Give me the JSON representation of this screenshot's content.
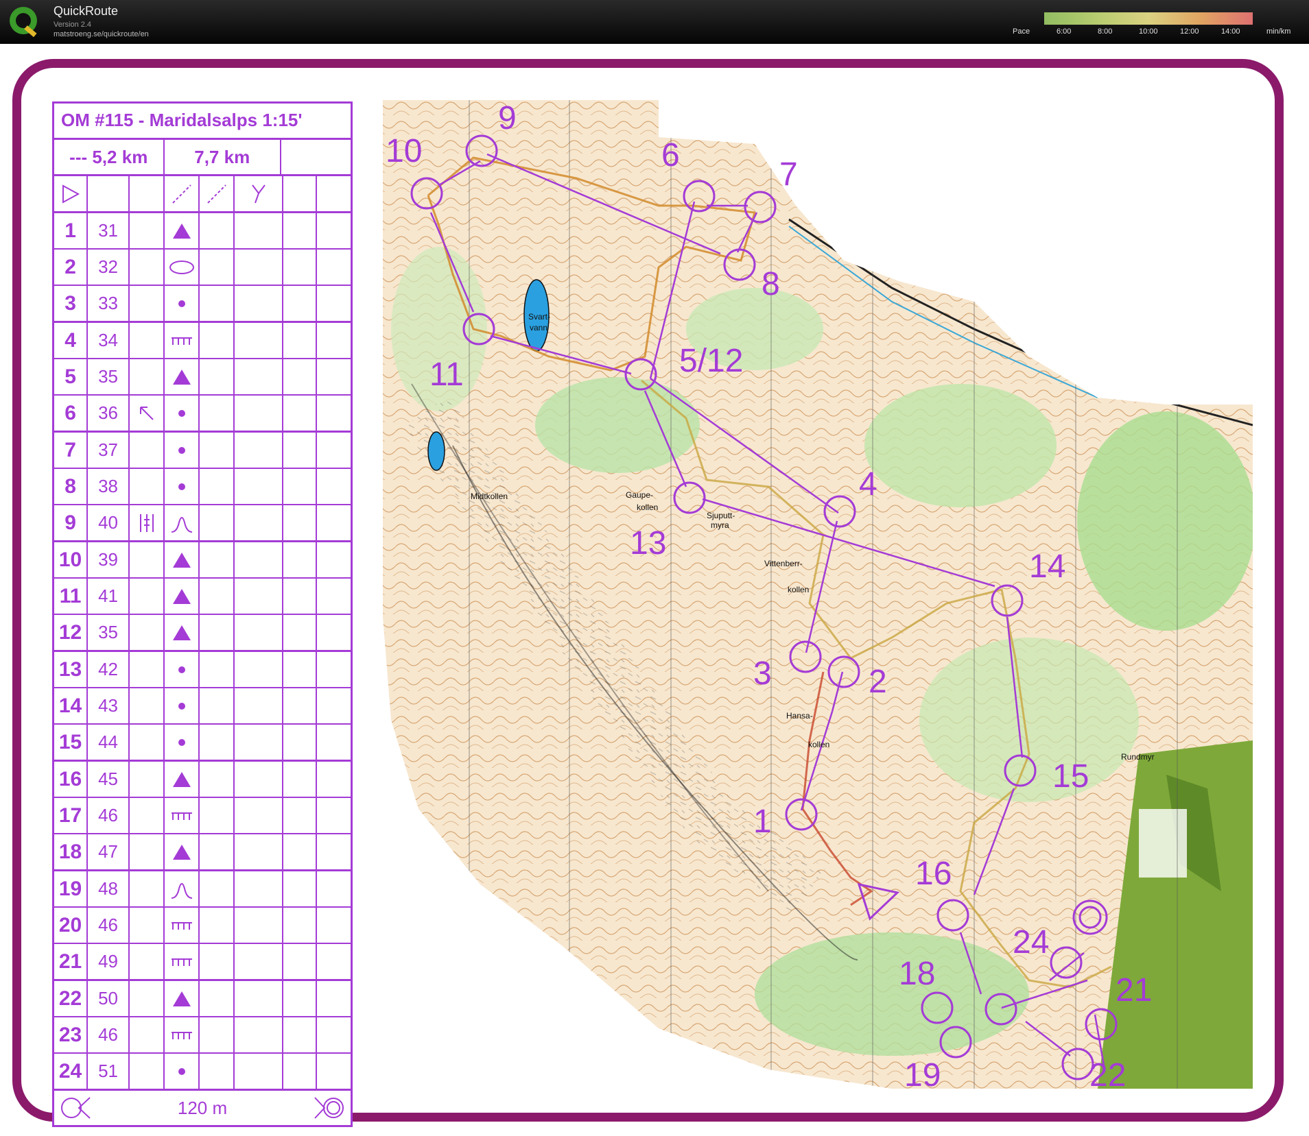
{
  "app": {
    "title": "QuickRoute",
    "version": "Version 2.4",
    "url": "matstroeng.se/quickroute/en"
  },
  "pace_legend": {
    "label": "Pace",
    "ticks": [
      "6:00",
      "8:00",
      "10:00",
      "12:00",
      "14:00"
    ],
    "unit": "min/km"
  },
  "colors": {
    "frame": "#8b1a6b",
    "course": "#a43bd6",
    "topbar": "#0a0a0a"
  },
  "description_sheet": {
    "title": "OM #115 - Maridalsalps 1:15'",
    "distance_short": "--- 5,2 km",
    "distance_long": "7,7 km",
    "footer": "120 m",
    "controls": [
      {
        "n": "1",
        "code": "31",
        "symbol": "triangle-icon"
      },
      {
        "n": "2",
        "code": "32",
        "symbol": "ellipse-icon"
      },
      {
        "n": "3",
        "code": "33",
        "symbol": "dot-icon"
      },
      {
        "n": "4",
        "code": "34",
        "symbol": "ruin-icon"
      },
      {
        "n": "5",
        "code": "35",
        "symbol": "triangle-icon"
      },
      {
        "n": "6",
        "code": "36",
        "symbol": "dot-icon",
        "extra": "arrow-nw-icon"
      },
      {
        "n": "7",
        "code": "37",
        "symbol": "dot-icon"
      },
      {
        "n": "8",
        "code": "38",
        "symbol": "dot-icon"
      },
      {
        "n": "9",
        "code": "40",
        "symbol": "hill-icon",
        "extra": "marsh-icon"
      },
      {
        "n": "10",
        "code": "39",
        "symbol": "triangle-icon"
      },
      {
        "n": "11",
        "code": "41",
        "symbol": "triangle-icon"
      },
      {
        "n": "12",
        "code": "35",
        "symbol": "triangle-icon"
      },
      {
        "n": "13",
        "code": "42",
        "symbol": "dot-icon"
      },
      {
        "n": "14",
        "code": "43",
        "symbol": "dot-icon"
      },
      {
        "n": "15",
        "code": "44",
        "symbol": "dot-icon"
      },
      {
        "n": "16",
        "code": "45",
        "symbol": "triangle-icon"
      },
      {
        "n": "17",
        "code": "46",
        "symbol": "ruin-icon"
      },
      {
        "n": "18",
        "code": "47",
        "symbol": "triangle-icon"
      },
      {
        "n": "19",
        "code": "48",
        "symbol": "hill-icon"
      },
      {
        "n": "20",
        "code": "46",
        "symbol": "ruin-icon"
      },
      {
        "n": "21",
        "code": "49",
        "symbol": "ruin-icon"
      },
      {
        "n": "22",
        "code": "50",
        "symbol": "triangle-icon"
      },
      {
        "n": "23",
        "code": "46",
        "symbol": "ruin-icon"
      },
      {
        "n": "24",
        "code": "51",
        "symbol": "dot-icon"
      }
    ]
  },
  "map": {
    "place_names": [
      "Svart-",
      "vann",
      "Midtkollen",
      "Gaupe-",
      "kollen",
      "Sjuputt-",
      "myra",
      "Vittenberr-",
      "kollen",
      "Hansa-",
      "kollen",
      "Rundmyr"
    ],
    "control_labels": [
      "9",
      "10",
      "6",
      "7",
      "8",
      "11",
      "5/12",
      "4",
      "13",
      "14",
      "3",
      "2",
      "1",
      "15",
      "16",
      "24",
      "18",
      "21",
      "19",
      "22"
    ]
  }
}
